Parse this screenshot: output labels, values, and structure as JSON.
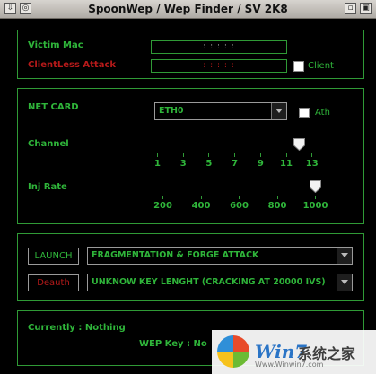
{
  "window": {
    "title": "SpoonWep / Wep Finder / SV 2K8"
  },
  "victim": {
    "mac_label": "Victim Mac",
    "mac_value": ": : : : :",
    "clientless_label": "ClientLess Attack",
    "clientless_value": ": : : : :",
    "client_label": "Client"
  },
  "netcard": {
    "label": "NET CARD",
    "selected": "ETH0",
    "ath_label": "Ath"
  },
  "channel": {
    "label": "Channel",
    "ticks": [
      "1",
      "3",
      "5",
      "7",
      "9",
      "11",
      "13"
    ],
    "value": 12
  },
  "inj_rate": {
    "label": "Inj Rate",
    "ticks": [
      "200",
      "400",
      "600",
      "800",
      "1000"
    ],
    "value": 1000
  },
  "attack": {
    "launch_label": "LAUNCH",
    "attack_selected": "FRAGMENTATION & FORGE ATTACK",
    "deauth_label": "Deauth",
    "keylength_selected": "UNKNOW KEY LENGHT (CRACKING AT 20000 IVS)"
  },
  "status": {
    "currently": "Currently : Nothing",
    "wep_key": "WEP Key : No"
  },
  "watermark": {
    "brand": "Win7",
    "suffix": "系统之家",
    "url": "Www.Winwin7.com"
  },
  "colors": {
    "accent": "#2fb53a",
    "danger": "#b71a1a",
    "background": "#000000"
  }
}
